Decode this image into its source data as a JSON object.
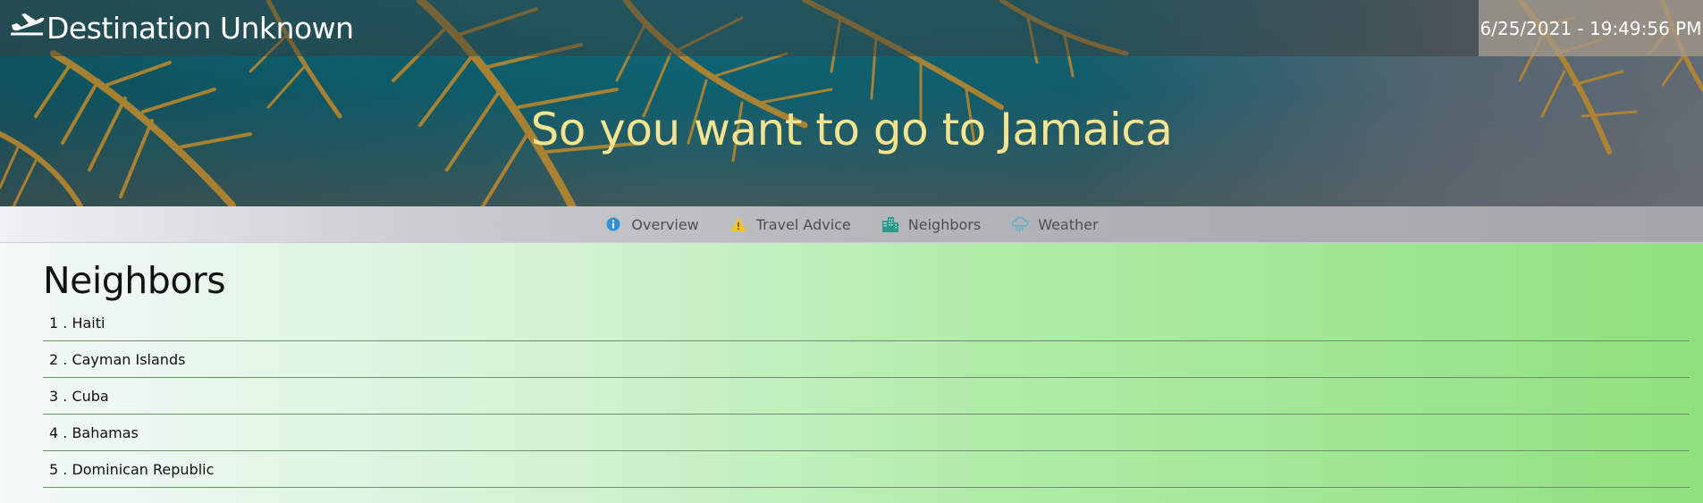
{
  "header": {
    "brand_title": "Destination Unknown",
    "brand_icon": "airplane-departure-icon",
    "datetime": "6/25/2021 - 19:49:56 PM"
  },
  "hero": {
    "heading": "So you want to go to Jamaica"
  },
  "nav": {
    "items": [
      {
        "label": "Overview",
        "icon": "info-icon",
        "color": "#2f8fd8"
      },
      {
        "label": "Travel Advice",
        "icon": "warning-icon",
        "color": "#f1c232"
      },
      {
        "label": "Neighbors",
        "icon": "city-buildings-icon",
        "color": "#2a9a8a"
      },
      {
        "label": "Weather",
        "icon": "cloud-rain-icon",
        "color": "#5fa9d6"
      }
    ]
  },
  "main": {
    "title": "Neighbors",
    "neighbors": [
      "1 . Haiti",
      "2 . Cayman Islands",
      "3 . Cuba",
      "4 . Bahamas",
      "5 . Dominican Republic"
    ]
  },
  "colors": {
    "heading_yellow": "#f5e48f",
    "background_green": "#8ee17e"
  }
}
